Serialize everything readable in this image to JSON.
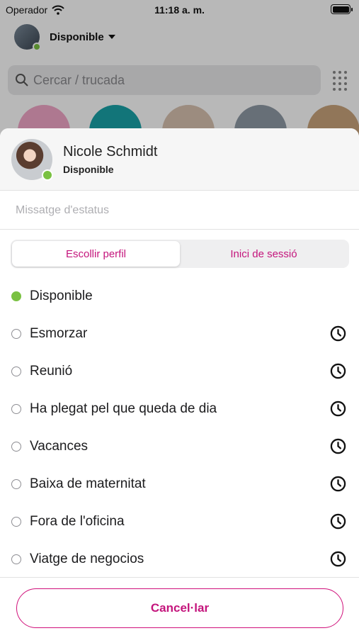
{
  "status_bar": {
    "carrier": "Operador",
    "time": "11:18 a. m."
  },
  "background": {
    "presence_label": "Disponible",
    "search_placeholder": "Cercar / trucada"
  },
  "sheet": {
    "profile": {
      "name": "Nicole Schmidt",
      "status": "Disponible"
    },
    "status_message_placeholder": "Missatge d'estatus",
    "tabs": [
      {
        "label": "Escollir perfil",
        "active": true
      },
      {
        "label": "Inici de sessió",
        "active": false
      }
    ],
    "statuses": [
      {
        "label": "Disponible",
        "selected": true,
        "timer": false
      },
      {
        "label": "Esmorzar",
        "selected": false,
        "timer": true
      },
      {
        "label": "Reunió",
        "selected": false,
        "timer": true
      },
      {
        "label": "Ha plegat pel que queda de dia",
        "selected": false,
        "timer": true
      },
      {
        "label": "Vacances",
        "selected": false,
        "timer": true
      },
      {
        "label": "Baixa de maternitat",
        "selected": false,
        "timer": true
      },
      {
        "label": "Fora de l'oficina",
        "selected": false,
        "timer": true
      },
      {
        "label": "Viatge de negocios",
        "selected": false,
        "timer": true
      }
    ],
    "cancel_label": "Cancel·lar"
  },
  "colors": {
    "accent": "#c4157c",
    "available": "#7ac142"
  }
}
